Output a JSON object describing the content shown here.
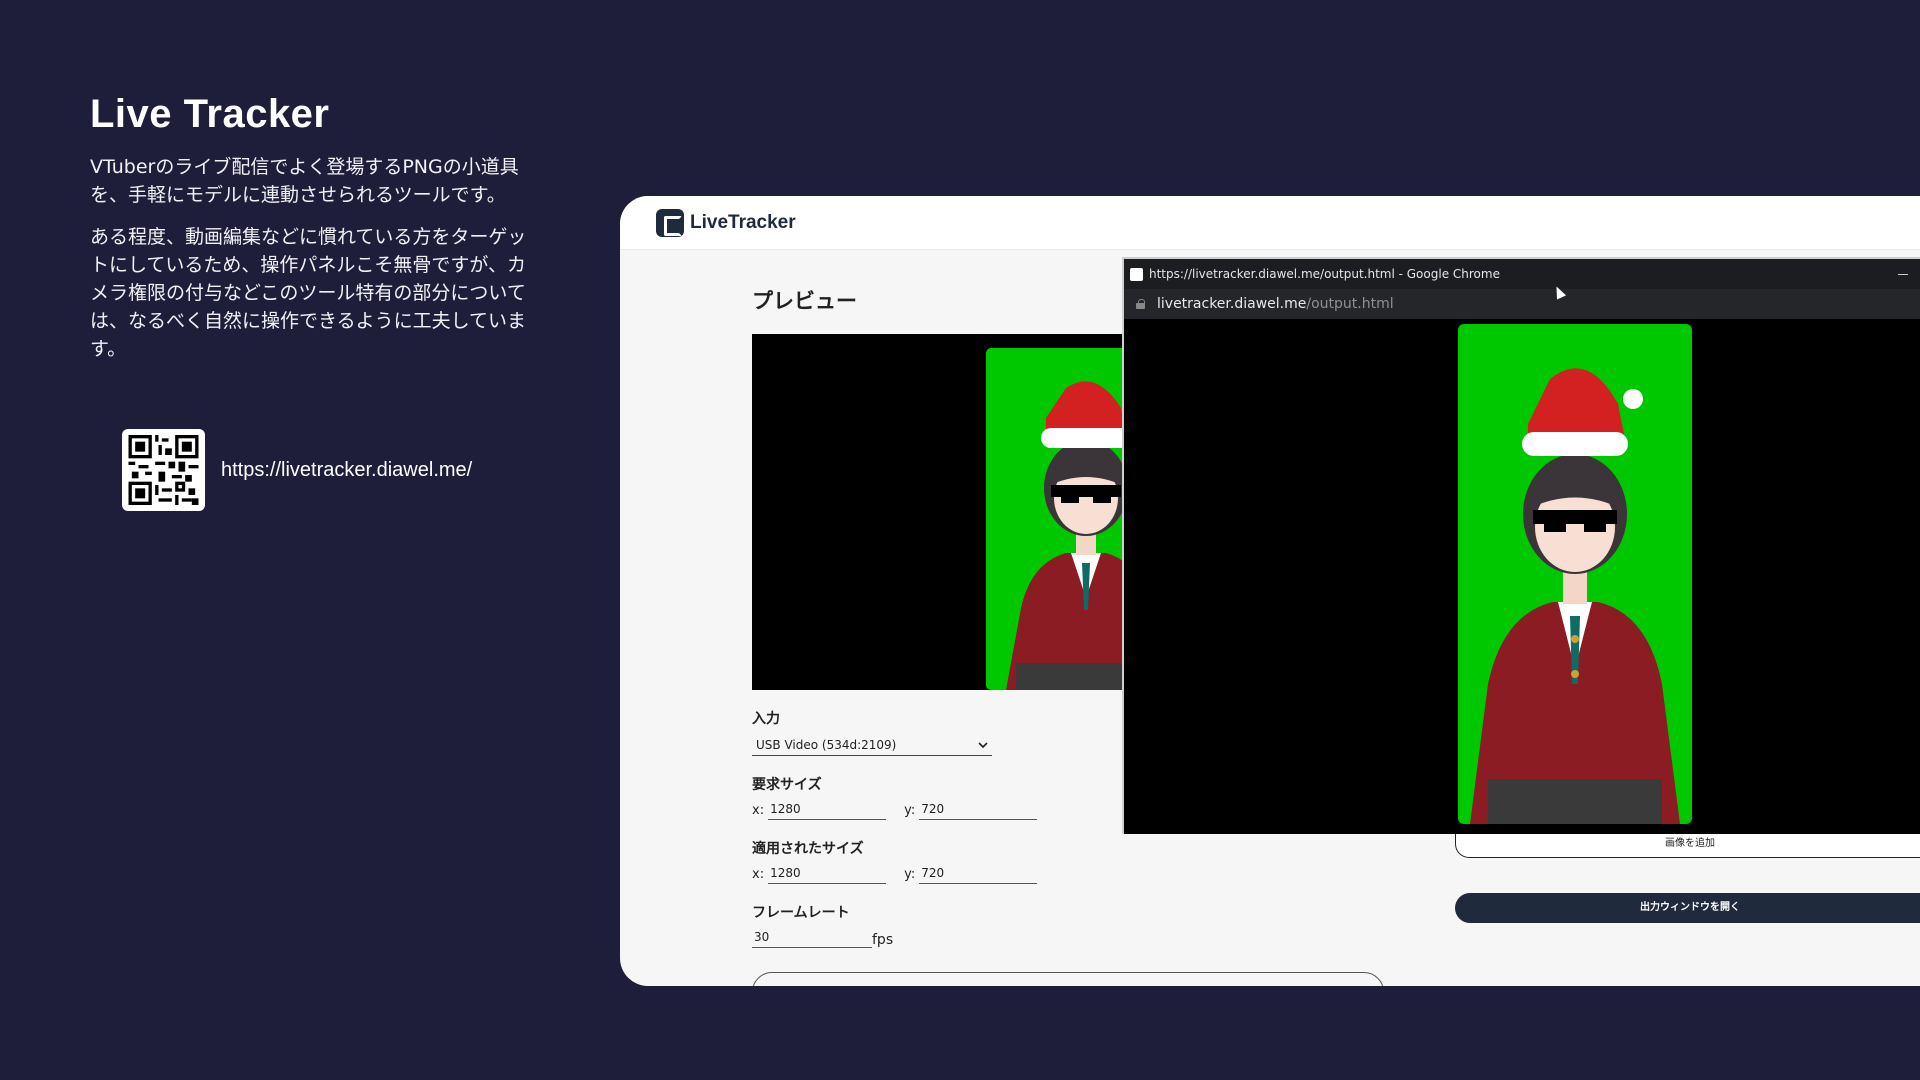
{
  "intro": {
    "title": "Live Tracker",
    "paragraph1": "VTuberのライブ配信でよく登場するPNGの小道具を、手軽にモデルに連動させられるツールです。",
    "paragraph2": "ある程度、動画編集などに慣れている方をターゲットにしているため、操作パネルこそ無骨ですが、カメラ権限の付与などこのツール特有の部分については、なるべく自然に操作できるように工夫しています。",
    "link": "https://livetracker.diawel.me/"
  },
  "app": {
    "logo_text": "LiveTracker",
    "preview_title": "プレビュー",
    "input": {
      "label": "入力",
      "selected": "USB Video (534d:2109)"
    },
    "requested_size": {
      "label": "要求サイズ",
      "x_label": "x:",
      "x_value": "1280",
      "y_label": "y:",
      "y_value": "720"
    },
    "applied_size": {
      "label": "適用されたサイズ",
      "x_label": "x:",
      "x_value": "1280",
      "y_label": "y:",
      "y_value": "720"
    },
    "framerate": {
      "label": "フレームレート",
      "value": "30",
      "unit": "fps"
    },
    "add_image_label": "画像を追加",
    "open_output_label": "出力ウィンドウを開く"
  },
  "popup": {
    "window_title": "https://livetracker.diawel.me/output.html - Google Chrome",
    "address_host": "livetracker.diawel.me",
    "address_path": "/output.html"
  },
  "colors": {
    "background": "#1f1e3a",
    "chroma_green": "#00c800",
    "button_dark": "#1f2a3d"
  },
  "icons": {
    "lock": "lock-icon",
    "chevron": "chevron-down-icon",
    "logo": "livetracker-logo-icon",
    "favicon": "favicon-icon"
  }
}
